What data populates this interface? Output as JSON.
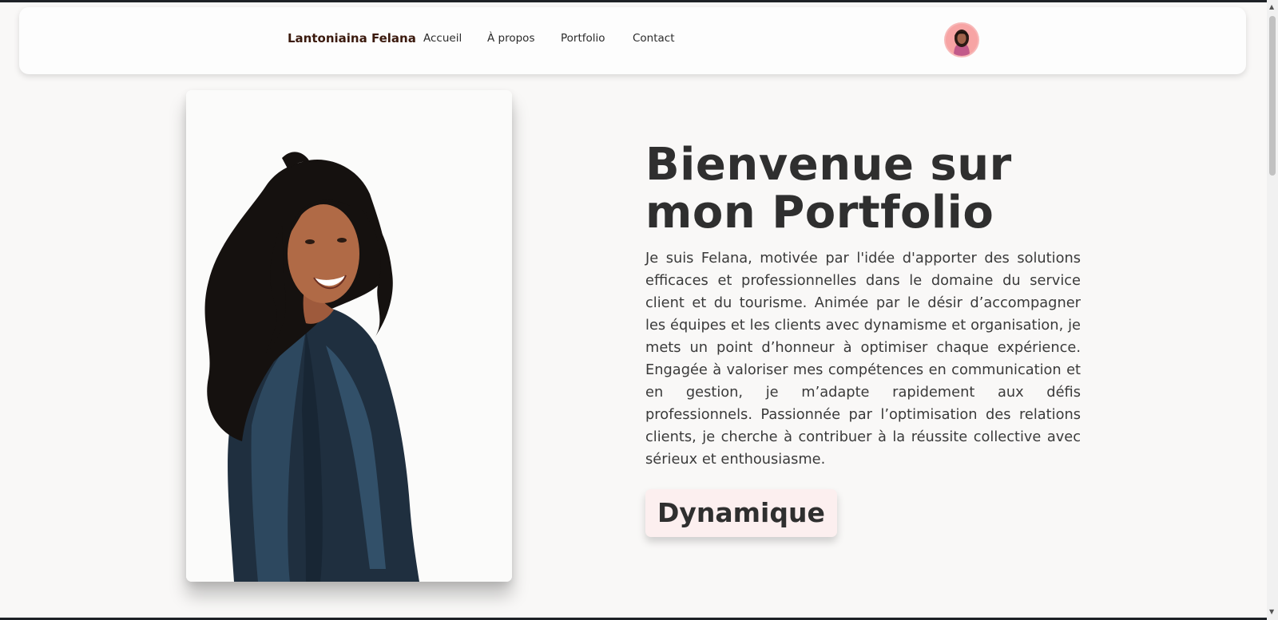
{
  "navbar": {
    "brand": "Lantoniaina Felana",
    "links": [
      "Accueil",
      "À propos",
      "Portfolio",
      "Contact"
    ]
  },
  "hero": {
    "title": "Bienvenue sur mon Portfolio",
    "description": "Je suis Felana, motivée par l'idée d'apporter des solutions efficaces et professionnelles dans le domaine du service client et du tourisme. Animée par le désir d’accompagner les équipes et les clients avec dynamisme et organisation, je mets un point d’honneur à optimiser chaque expérience. Engagée à valoriser mes compétences en communication et en gestion, je m’adapte rapidement aux défis professionnels. Passionnée par l’optimisation des relations clients, je cherche à contribuer à la réussite collective avec sérieux et enthousiasme.",
    "typed_word": "Dynamique"
  },
  "colors": {
    "page_background": "#f9f8f7",
    "brand_text": "#3b1a0e",
    "tag_background": "#fcefef",
    "avatar_background": "#f7a4a4"
  }
}
